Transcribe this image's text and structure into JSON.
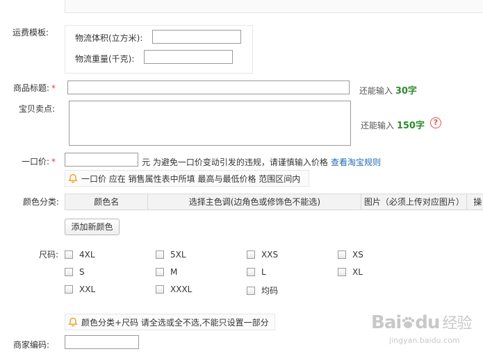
{
  "shipping_template": {
    "label": "运费模板:",
    "volume_label": "物流体积(立方米):",
    "volume_value": "",
    "weight_label": "物流重量(千克):",
    "weight_value": ""
  },
  "title_field": {
    "label": "商品标题:",
    "required_mark": "*",
    "value": "",
    "counter_prefix": "还能输入",
    "counter_value": "30字"
  },
  "selling_points": {
    "label": "宝贝卖点:",
    "value": "",
    "counter_prefix": "还能输入",
    "counter_value": "150字",
    "help_icon": "?"
  },
  "price": {
    "label": "一口价:",
    "required_mark": "*",
    "value": "",
    "unit_hint": "元 为避免一口价变动引发的违规，请谨慎输入价格",
    "rules_link": "查看淘宝规则",
    "notice": "一口价 应在 销售属性表中所填 最高与最低价格 范围区间内"
  },
  "color": {
    "label": "颜色分类:",
    "columns": [
      "颜色名",
      "选择主色调(边角色或修饰色不能选)",
      "图片（必须上传对应图片）",
      "操"
    ],
    "add_button": "添加新颜色"
  },
  "size": {
    "label": "尺码:",
    "options": [
      "4XL",
      "5XL",
      "XXS",
      "XS",
      "S",
      "M",
      "L",
      "XL",
      "XXL",
      "XXXL",
      "均码"
    ],
    "notice": "颜色分类+尺码 请全选或全不选,不能只设置一部分"
  },
  "merchant_code": {
    "label": "商家编码:",
    "value": ""
  },
  "watermark": {
    "brand": "Bai",
    "brand_tail": "du",
    "cn": "经验",
    "url": "jingyan.baidu.com"
  },
  "colors": {
    "accent_green": "#2c8a2c",
    "link_blue": "#1f6bb5",
    "required_red": "#e4393c",
    "bell_orange": "#f0a020"
  }
}
